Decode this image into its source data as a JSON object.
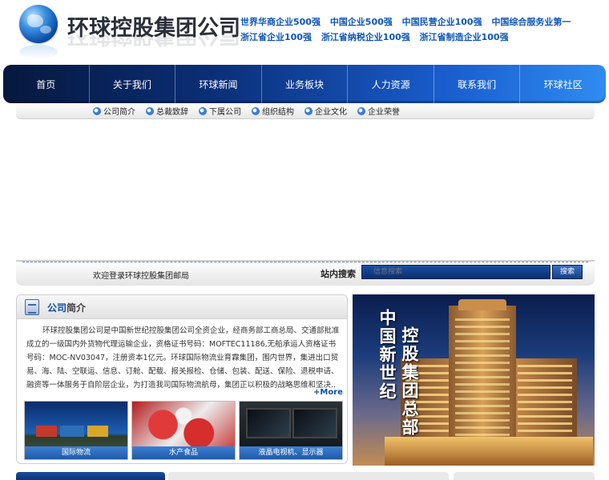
{
  "header": {
    "logo_text": "环球控股集团公司",
    "rankings_line1": [
      "世界华商企业500强",
      "中国企业500强",
      "中国民营企业100强",
      "中国综合服务业第一"
    ],
    "rankings_line2": [
      "浙江省企业100强",
      "浙江省纳税企业100强",
      "浙江省制造企业100强"
    ]
  },
  "nav": {
    "items": [
      "首页",
      "关于我们",
      "环球新闻",
      "业务板块",
      "人力资源",
      "联系我们",
      "环球社区"
    ]
  },
  "subnav": {
    "items": [
      "公司简介",
      "总裁致辞",
      "下属公司",
      "组织结构",
      "企业文化",
      "企业荣誉"
    ]
  },
  "search": {
    "welcome": "欢迎登录环球控股集团邮局",
    "label": "站内搜索",
    "placeholder": "信息搜索",
    "button": "搜索"
  },
  "about": {
    "title_part1": "公司",
    "title_part2": "简介",
    "body": "环球控股集团公司是中国新世纪控股集团公司全资企业，经商务部工商总局、交通部批准成立的一级国内外货物代理运输企业，资格证书号码：MOFTEC11186,无船承运人资格证书号码：MOC-NV03047，注册资本1亿元。环球国际物流业育霖集团，围内世界，集进出口贸易、海、陆、空联运、信息、订舱、配载、报关报检、仓储、包装、配送、保险、退税申请、融资等一体服务于自阶层企业，为打造我司国际物流航母，集团正以积极的战略思维和坚决..",
    "more": "+More",
    "thumbs": [
      "国际物流",
      "水产食品",
      "液晶电视机、显示器"
    ]
  },
  "building": {
    "text_col1": "中国新世纪",
    "text_col2": "控股集团总部"
  },
  "colors": {
    "nav_dark": "#06183d",
    "nav_light": "#2f8cf0",
    "ranking_blue": "#0d55b8"
  }
}
